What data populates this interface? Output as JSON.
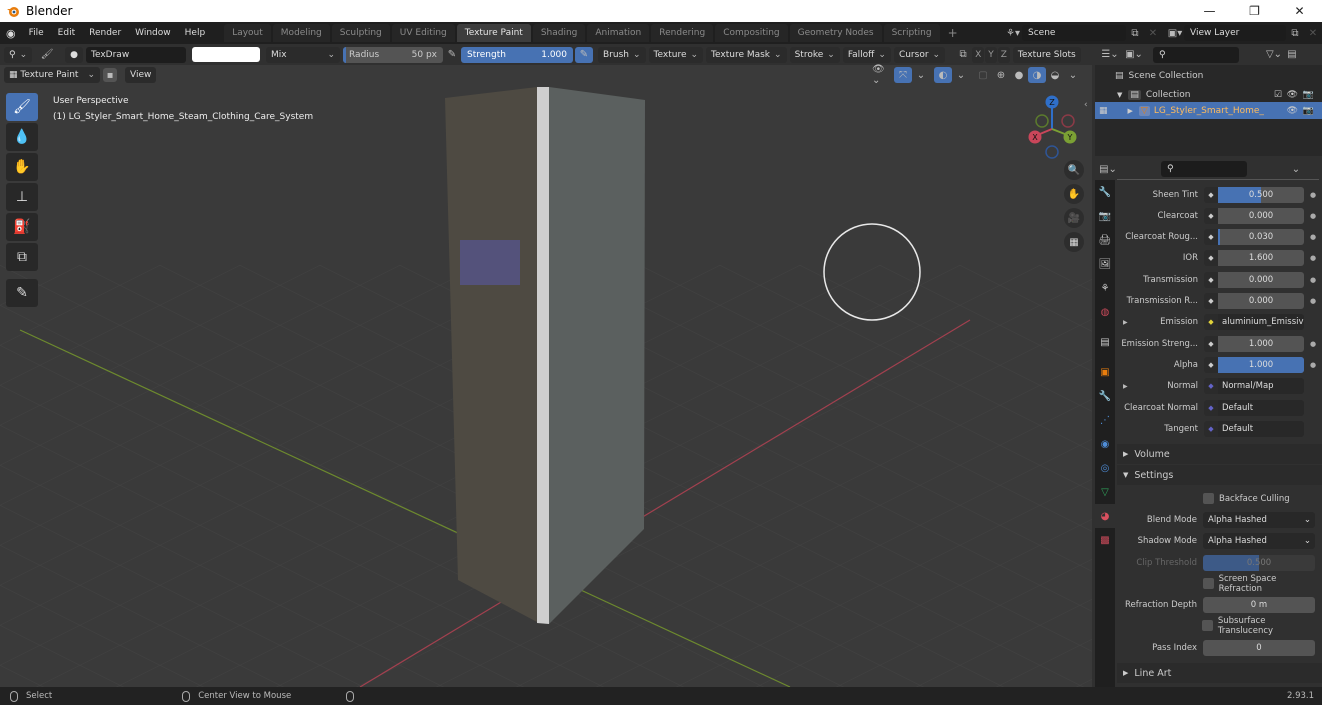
{
  "window": {
    "title": "Blender",
    "minimize": "—",
    "maximize": "❐",
    "close": "✕"
  },
  "menu": [
    "File",
    "Edit",
    "Render",
    "Window",
    "Help"
  ],
  "workspaces": [
    "Layout",
    "Modeling",
    "Sculpting",
    "UV Editing",
    "Texture Paint",
    "Shading",
    "Animation",
    "Rendering",
    "Compositing",
    "Geometry Nodes",
    "Scripting"
  ],
  "active_workspace": "Texture Paint",
  "scene": {
    "name": "Scene",
    "view_layer": "View Layer"
  },
  "tool_header": {
    "brush_name": "TexDraw",
    "blend_mode": "Mix",
    "radius_label": "Radius",
    "radius_value": "50 px",
    "strength_label": "Strength",
    "strength_value": "1.000",
    "strength_fraction": 1.0,
    "menus": [
      "Brush",
      "Texture",
      "Texture Mask",
      "Stroke",
      "Falloff",
      "Cursor"
    ],
    "axes": [
      "X",
      "Y",
      "Z"
    ],
    "texture_slots": "Texture Slots"
  },
  "viewport_header": {
    "mode": "Texture Paint",
    "view_menu": "View"
  },
  "viewport": {
    "perspective": "User Perspective",
    "object_info": "(1) LG_Styler_Smart_Home_Steam_Clothing_Care_System",
    "gizmo": {
      "x": "X",
      "y": "Y",
      "z": "Z"
    },
    "colors": {
      "x_axis": "#c9465a",
      "y_axis": "#7ba034",
      "z_axis": "#2f6fc9"
    }
  },
  "tools": [
    "draw-brush",
    "soften-brush",
    "smear-brush",
    "clone-brush",
    "fill-brush",
    "mask-brush",
    "annotate"
  ],
  "outliner": {
    "scene_collection": "Scene Collection",
    "collection": "Collection",
    "object": "LG_Styler_Smart_Home_"
  },
  "properties": {
    "rows": [
      {
        "label": "Sheen Tint",
        "value": "0.500",
        "fraction": 0.5,
        "highlight": true
      },
      {
        "label": "Clearcoat",
        "value": "0.000",
        "fraction": 0
      },
      {
        "label": "Clearcoat Roug...",
        "value": "0.030",
        "fraction": 0.03
      },
      {
        "label": "IOR",
        "value": "1.600",
        "fraction": 0
      },
      {
        "label": "Transmission",
        "value": "0.000",
        "fraction": 0
      },
      {
        "label": "Transmission R...",
        "value": "0.000",
        "fraction": 0
      },
      {
        "label": "Emission",
        "link": "aluminium_Emissive...",
        "socket_color": "#e0d23a",
        "expandable": true
      },
      {
        "label": "Emission Streng...",
        "value": "1.000",
        "fraction": 0
      },
      {
        "label": "Alpha",
        "value": "1.000",
        "fraction": 1.0,
        "highlight": true
      },
      {
        "label": "Normal",
        "link": "Normal/Map",
        "socket_color": "#6363c7",
        "expandable": true
      },
      {
        "label": "Clearcoat Normal",
        "link": "Default",
        "socket_color": "#6363c7"
      },
      {
        "label": "Tangent",
        "link": "Default",
        "socket_color": "#6363c7"
      }
    ],
    "panels": {
      "volume": "Volume",
      "settings": "Settings",
      "line_art": "Line Art"
    },
    "settings": {
      "backface_culling": "Backface Culling",
      "blend_mode_label": "Blend Mode",
      "blend_mode": "Alpha Hashed",
      "shadow_mode_label": "Shadow Mode",
      "shadow_mode": "Alpha Hashed",
      "clip_threshold_label": "Clip Threshold",
      "clip_threshold": "0.500",
      "clip_fraction": 0.5,
      "ssr_label": "Screen Space Refraction",
      "refraction_depth_label": "Refraction Depth",
      "refraction_depth": "0 m",
      "subsurface_label": "Subsurface Translucency",
      "pass_index_label": "Pass Index",
      "pass_index": "0"
    }
  },
  "statusbar": {
    "select": "Select",
    "center": "Center View to Mouse",
    "version": "2.93.1"
  },
  "colors": {
    "accent": "#4772b3",
    "orange": "#e87d0d"
  }
}
